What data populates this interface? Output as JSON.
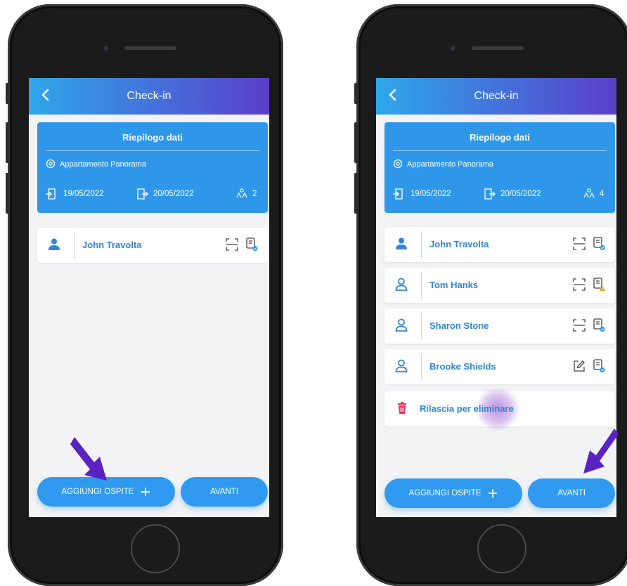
{
  "screens": [
    {
      "title": "Check-in",
      "summary": {
        "title": "Riepilogo dati",
        "property": "Appartamento Panorama",
        "checkin": "19/05/2022",
        "checkout": "20/05/2022",
        "guests_count": "2"
      },
      "guests": [
        {
          "name": "John Travolta",
          "icon": "person-filled-icon",
          "action": "scan-icon",
          "doc_status": "ok"
        }
      ],
      "buttons": {
        "add_label": "AGGIUNGI OSPITE",
        "next_label": "AVANTI"
      }
    },
    {
      "title": "Check-in",
      "summary": {
        "title": "Riepilogo dati",
        "property": "Appartamento Panorama",
        "checkin": "19/05/2022",
        "checkout": "20/05/2022",
        "guests_count": "4"
      },
      "guests": [
        {
          "name": "John Travolta",
          "icon": "person-filled-icon",
          "action": "scan-icon",
          "doc_status": "ok"
        },
        {
          "name": "Tom Hanks",
          "icon": "person-outline-icon",
          "action": "scan-icon",
          "doc_status": "warning"
        },
        {
          "name": "Sharon Stone",
          "icon": "person-outline-icon",
          "action": "scan-icon",
          "doc_status": "ok"
        },
        {
          "name": "Brooke Shields",
          "icon": "person-outline-icon",
          "action": "edit-icon",
          "doc_status": "ok"
        }
      ],
      "remove_label": "Rilascia per eliminare",
      "buttons": {
        "add_label": "AGGIUNGI OSPITE",
        "next_label": "AVANTI"
      }
    }
  ],
  "colors": {
    "primary": "#2f97ea",
    "accent_purple": "#5a3fc8",
    "arrow": "#5b22c2",
    "guest_name": "#2f86d8",
    "delete_red": "#e8325a",
    "warning": "#f3a21c"
  }
}
